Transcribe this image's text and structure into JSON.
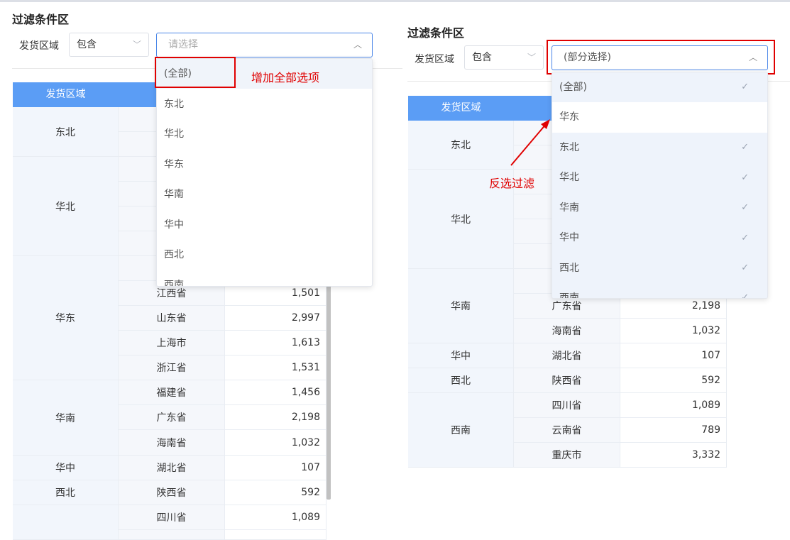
{
  "left": {
    "section_title": "过滤条件区",
    "field_label": "发货区域",
    "operator": "包含",
    "placeholder": "请选择",
    "dropdown_options": [
      "(全部)",
      "东北",
      "华北",
      "华东",
      "华南",
      "华中",
      "西北",
      "西南"
    ],
    "annotation": "增加全部选项",
    "table_header": "发货区域",
    "rows": [
      {
        "region": "东北",
        "province": "",
        "value": ""
      },
      {
        "region": "华北",
        "province": "",
        "value": ""
      },
      {
        "region": "华东",
        "provinces": [
          {
            "province": "江西省",
            "value": "1,501"
          },
          {
            "province": "山东省",
            "value": "2,997"
          },
          {
            "province": "上海市",
            "value": "1,613"
          },
          {
            "province": "浙江省",
            "value": "1,531"
          }
        ]
      },
      {
        "region": "华南",
        "provinces": [
          {
            "province": "福建省",
            "value": "1,456"
          },
          {
            "province": "广东省",
            "value": "2,198"
          },
          {
            "province": "海南省",
            "value": "1,032"
          }
        ]
      },
      {
        "region": "华中",
        "provinces": [
          {
            "province": "湖北省",
            "value": "107"
          }
        ]
      },
      {
        "region": "西北",
        "provinces": [
          {
            "province": "陕西省",
            "value": "592"
          }
        ]
      },
      {
        "region": "",
        "provinces": [
          {
            "province": "四川省",
            "value": "1,089"
          }
        ]
      }
    ]
  },
  "right": {
    "section_title": "过滤条件区",
    "field_label": "发货区域",
    "operator": "包含",
    "selected_text": "(部分选择)",
    "dropdown_options": [
      {
        "label": "(全部)",
        "checked": true
      },
      {
        "label": "华东",
        "checked": false
      },
      {
        "label": "东北",
        "checked": true
      },
      {
        "label": "华北",
        "checked": true
      },
      {
        "label": "华南",
        "checked": true
      },
      {
        "label": "华中",
        "checked": true
      },
      {
        "label": "西北",
        "checked": true
      },
      {
        "label": "西南",
        "checked": true
      }
    ],
    "check_glyph": "✓",
    "annotation": "反选过滤",
    "table_header": "发货区域",
    "regions": {
      "r0": "东北",
      "r1": "华北",
      "r2": "华南",
      "r3": "华中",
      "r4": "西北",
      "r5": "西南"
    },
    "provinces": {
      "p0": {
        "province": "广东省",
        "value": "2,198"
      },
      "p1": {
        "province": "海南省",
        "value": "1,032"
      },
      "p2": {
        "province": "湖北省",
        "value": "107"
      },
      "p3": {
        "province": "陕西省",
        "value": "592"
      },
      "p4": {
        "province": "四川省",
        "value": "1,089"
      },
      "p5": {
        "province": "云南省",
        "value": "789"
      },
      "p6": {
        "province": "重庆市",
        "value": "3,332"
      }
    }
  },
  "icons": {
    "chevron_down": "chevron-down-icon",
    "chevron_up": "chevron-up-icon",
    "check": "check-icon"
  },
  "colors": {
    "header_blue": "#5b9df5",
    "highlight_red": "#e00000",
    "focus_blue": "#4a86e8"
  }
}
